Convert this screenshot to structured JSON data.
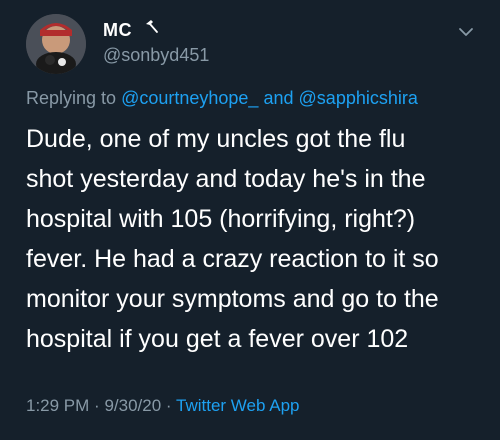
{
  "author": {
    "name": "MC",
    "handle": "@sonbyd451",
    "name_icon": "hammer-icon",
    "avatar_icon": "avatar-icon"
  },
  "menu_icon": "chevron-down-icon",
  "reply": {
    "prefix": "Replying to",
    "mention1": "@courtneyhope_",
    "conjunction": "and",
    "mention2": "@sapphicshira"
  },
  "tweet": {
    "lines": [
      "Dude, one of my uncles got the flu",
      "shot yesterday and today he's in the",
      "hospital with 105 (horrifying, right?)",
      "fever. He had a crazy reaction to it so",
      "monitor your symptoms and go to the",
      "hospital if you get a fever over 102"
    ]
  },
  "meta": {
    "time": "1:29 PM",
    "separator1": "·",
    "date": "9/30/20",
    "separator2": "·",
    "source": "Twitter Web App"
  },
  "colors": {
    "background": "#15202b",
    "primary_text": "#ffffff",
    "secondary_text": "#8899a6",
    "link": "#1da1f2"
  }
}
